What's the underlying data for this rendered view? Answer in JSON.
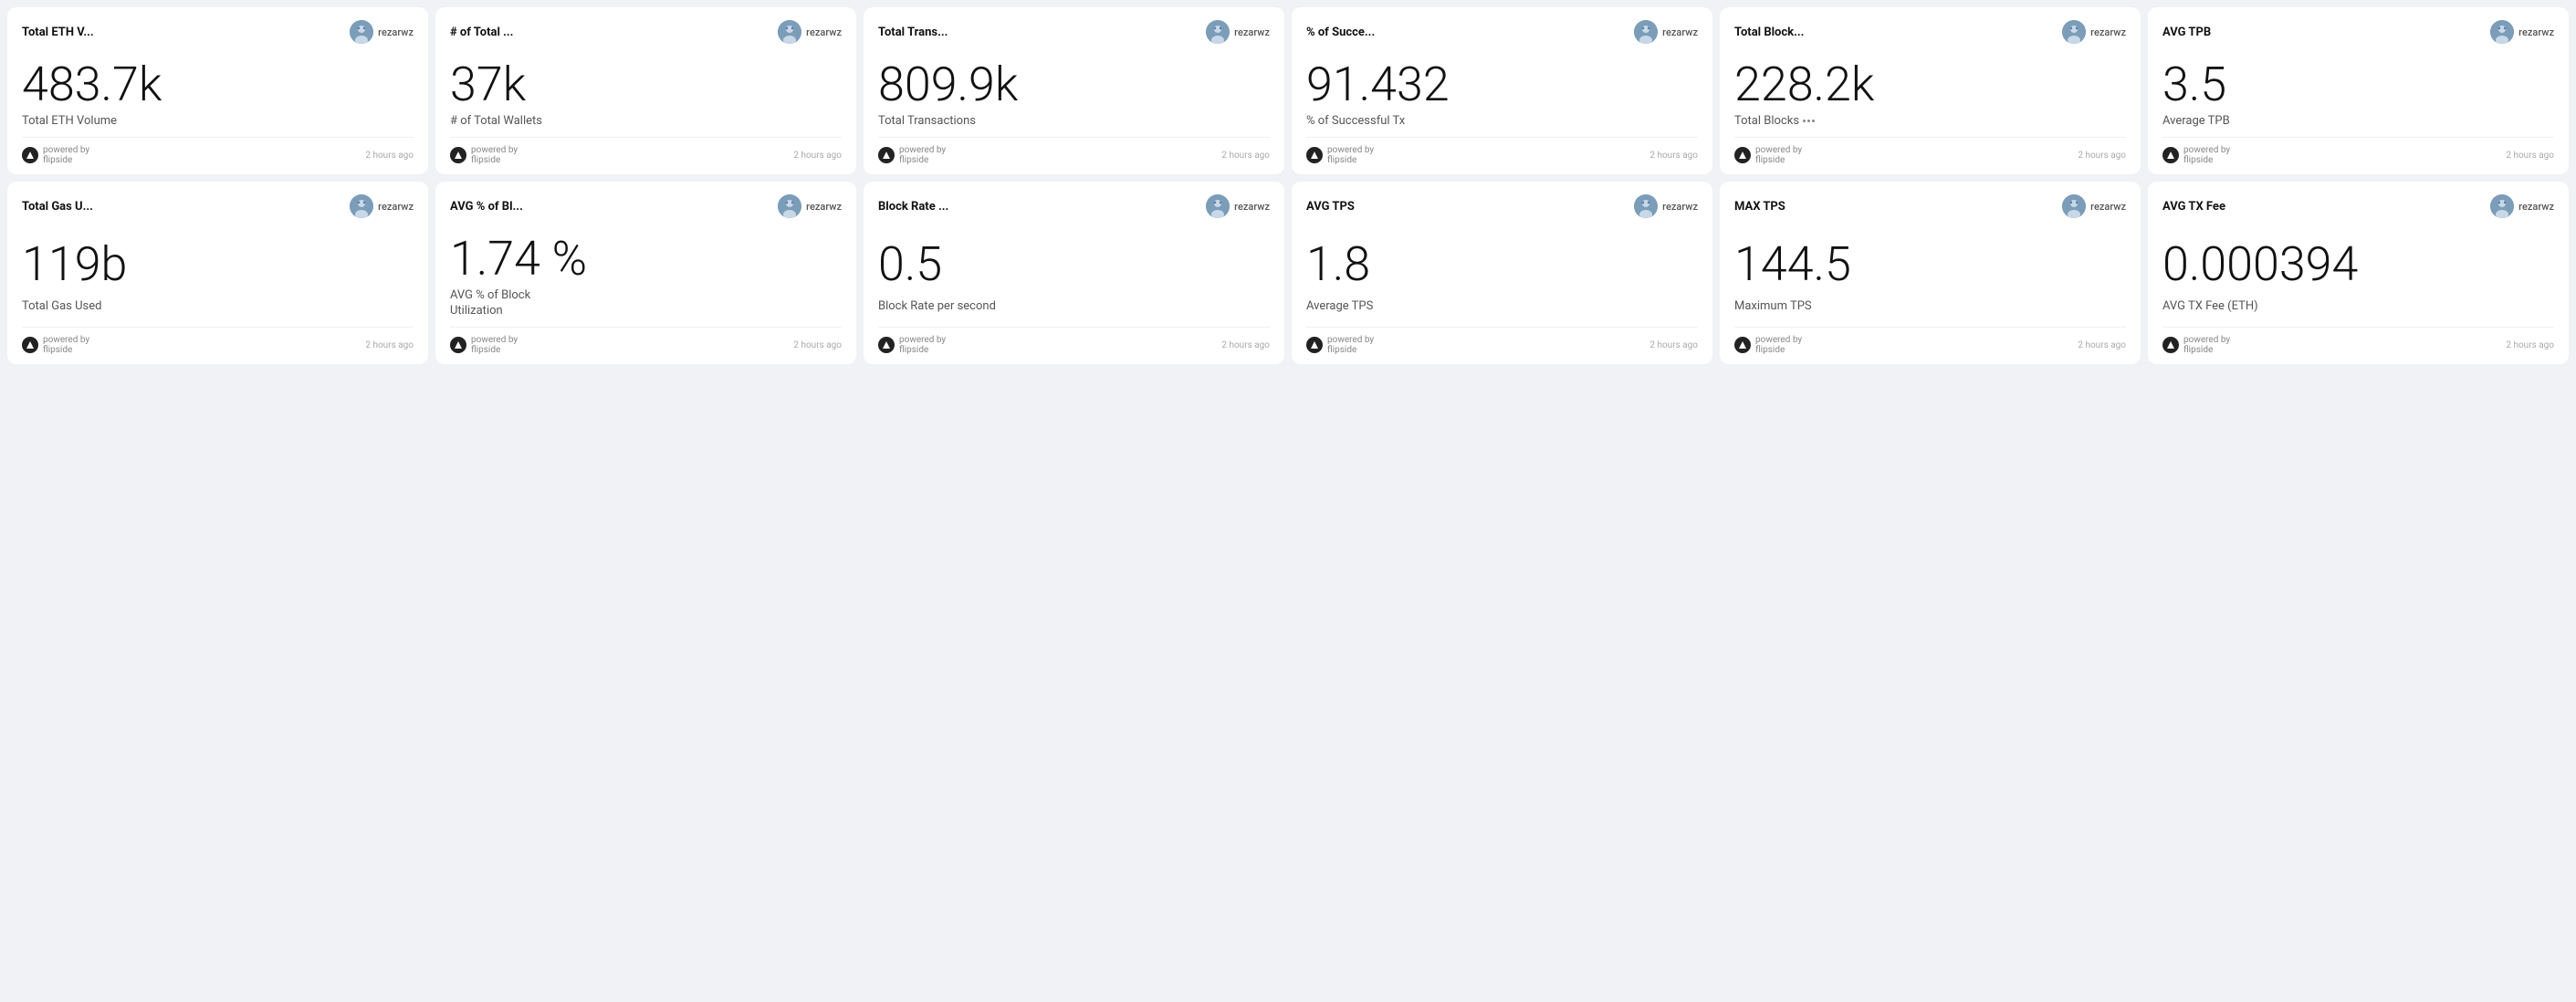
{
  "cards": [
    {
      "id": "total-eth-volume",
      "title": "Total ETH V...",
      "author": "rezarwz",
      "value": "483.7k",
      "label": "Total ETH Volume",
      "powered_by": "powered by flipside",
      "timestamp": "2 hours ago",
      "has_filter": false
    },
    {
      "id": "total-wallets",
      "title": "# of Total ...",
      "author": "rezarwz",
      "value": "37k",
      "label": "# of Total Wallets",
      "powered_by": "powered by flipside",
      "timestamp": "2 hours ago",
      "has_filter": false
    },
    {
      "id": "total-transactions",
      "title": "Total Trans...",
      "author": "rezarwz",
      "value": "809.9k",
      "label": "Total Transactions",
      "powered_by": "powered by flipside",
      "timestamp": "2 hours ago",
      "has_filter": false
    },
    {
      "id": "pct-successful",
      "title": "% of Succe...",
      "author": "rezarwz",
      "value": "91.432",
      "label": "% of Successful Tx",
      "powered_by": "powered by flipside",
      "timestamp": "2 hours ago",
      "has_filter": false
    },
    {
      "id": "total-blocks",
      "title": "Total Block...",
      "author": "rezarwz",
      "value": "228.2k",
      "label": "Total Blocks",
      "powered_by": "powered by flipside",
      "timestamp": "2 hours ago",
      "has_filter": true
    },
    {
      "id": "avg-tpb",
      "title": "AVG TPB",
      "author": "rezarwz",
      "value": "3.5",
      "label": "Average TPB",
      "powered_by": "powered by flipside",
      "timestamp": "2 hours ago",
      "has_filter": false
    },
    {
      "id": "total-gas-used",
      "title": "Total Gas U...",
      "author": "rezarwz",
      "value": "119b",
      "label": "Total Gas Used",
      "powered_by": "powered by flipside",
      "timestamp": "2 hours ago",
      "has_filter": false
    },
    {
      "id": "avg-pct-block-util",
      "title": "AVG % of Bl...",
      "author": "rezarwz",
      "value": "1.74 %",
      "label": "AVG % of Block\nUtilization",
      "powered_by": "powered by flipside",
      "timestamp": "2 hours ago",
      "has_filter": false
    },
    {
      "id": "block-rate",
      "title": "Block Rate ...",
      "author": "rezarwz",
      "value": "0.5",
      "label": "Block Rate per second",
      "powered_by": "powered by flipside",
      "timestamp": "2 hours ago",
      "has_filter": false
    },
    {
      "id": "avg-tps",
      "title": "AVG TPS",
      "author": "rezarwz",
      "value": "1.8",
      "label": "Average TPS",
      "powered_by": "powered by flipside",
      "timestamp": "2 hours ago",
      "has_filter": false
    },
    {
      "id": "max-tps",
      "title": "MAX TPS",
      "author": "rezarwz",
      "value": "144.5",
      "label": "Maximum TPS",
      "powered_by": "powered by flipside",
      "timestamp": "2 hours ago",
      "has_filter": false
    },
    {
      "id": "avg-tx-fee",
      "title": "AVG TX Fee",
      "author": "rezarwz",
      "value": "0.000394",
      "label": "AVG TX Fee (ETH)",
      "powered_by": "powered by flipside",
      "timestamp": "2 hours ago",
      "has_filter": false
    }
  ],
  "labels": {
    "powered_by": "powered by",
    "flipside": "flipside"
  }
}
